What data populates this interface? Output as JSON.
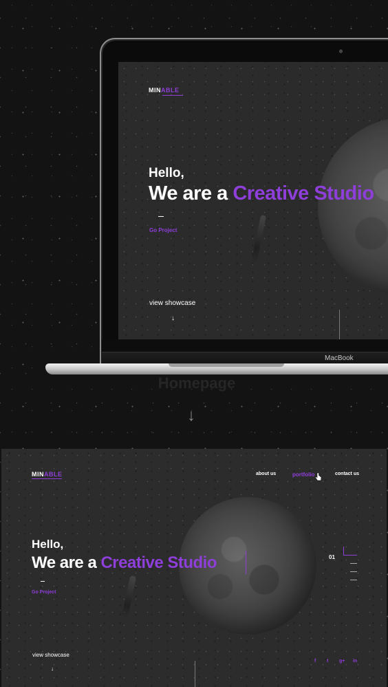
{
  "colors": {
    "accent": "#8e3ed9",
    "background": "#131313",
    "screen": "#2b2b2b"
  },
  "logo": {
    "plain": "MIN",
    "accent": "ABLE"
  },
  "hero": {
    "hello": "Hello,",
    "we_are_a": "We are a",
    "creative_studio": "Creative Studio",
    "creative_studio_cropped": "Creative Studio"
  },
  "cta": {
    "go_project": "Go Project",
    "view_showcase": "view showcase",
    "arrow": "↓"
  },
  "laptop": {
    "brand": "MacBook"
  },
  "caption": {
    "homepage": "Homepage",
    "section_arrow": "↓"
  },
  "nav": {
    "about": "about us",
    "portfolio": "portfolio",
    "contact": "contact us"
  },
  "slider": {
    "current": "01"
  },
  "social": [
    {
      "icon": "facebook-icon",
      "glyph": "f"
    },
    {
      "icon": "twitter-icon",
      "glyph": "t"
    },
    {
      "icon": "google-plus-icon",
      "glyph": "g+"
    },
    {
      "icon": "linkedin-icon",
      "glyph": "in"
    }
  ]
}
